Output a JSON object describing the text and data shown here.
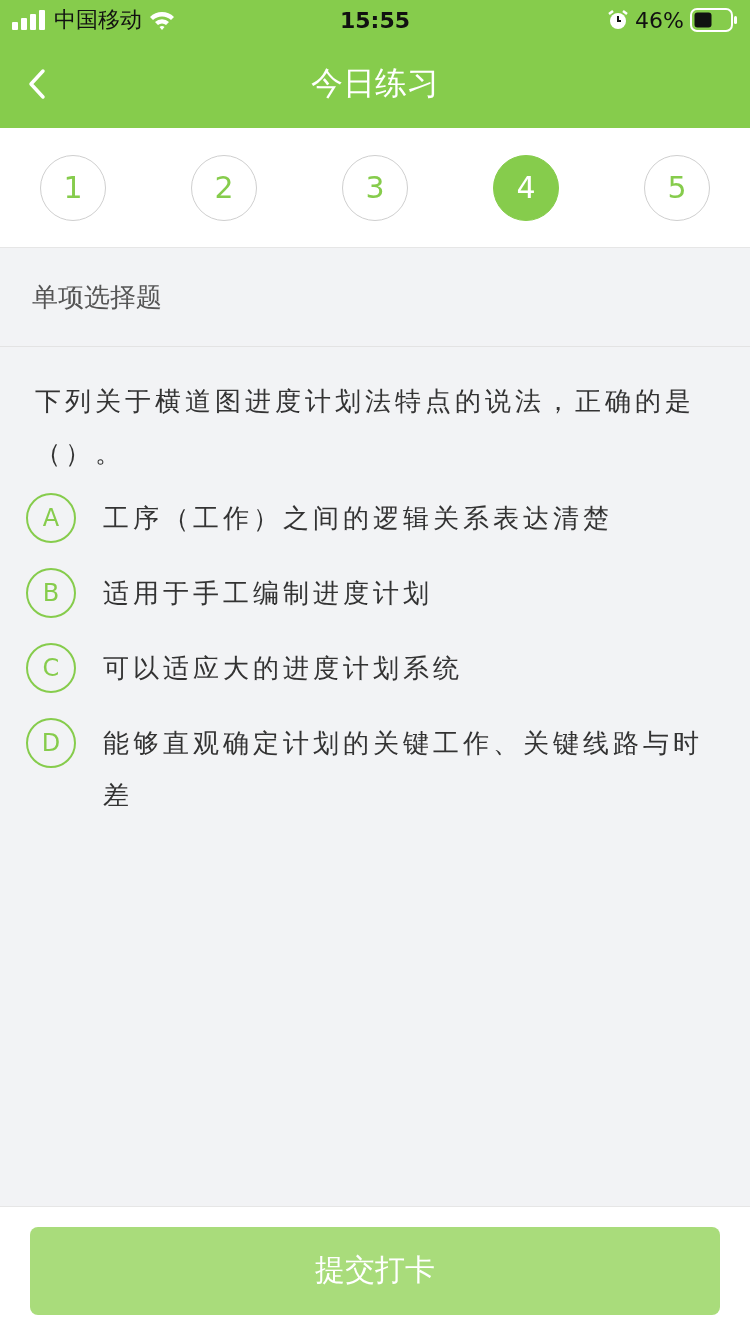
{
  "status_bar": {
    "carrier": "中国移动",
    "time": "15:55",
    "battery": "46%"
  },
  "nav": {
    "title": "今日练习"
  },
  "question_numbers": [
    {
      "label": "1",
      "selected": false
    },
    {
      "label": "2",
      "selected": false
    },
    {
      "label": "3",
      "selected": false
    },
    {
      "label": "4",
      "selected": true
    },
    {
      "label": "5",
      "selected": false
    }
  ],
  "question_type": "单项选择题",
  "question": "下列关于横道图进度计划法特点的说法，正确的是（）。",
  "options": [
    {
      "letter": "A",
      "text": "工序（工作）之间的逻辑关系表达清楚",
      "selected": false
    },
    {
      "letter": "B",
      "text": "适用于手工编制进度计划",
      "selected": false
    },
    {
      "letter": "C",
      "text": "可以适应大的进度计划系统",
      "selected": false
    },
    {
      "letter": "D",
      "text": "能够直观确定计划的关键工作、关键线路与时差",
      "selected": false
    }
  ],
  "submit": {
    "label": "提交打卡",
    "disabled": true
  }
}
